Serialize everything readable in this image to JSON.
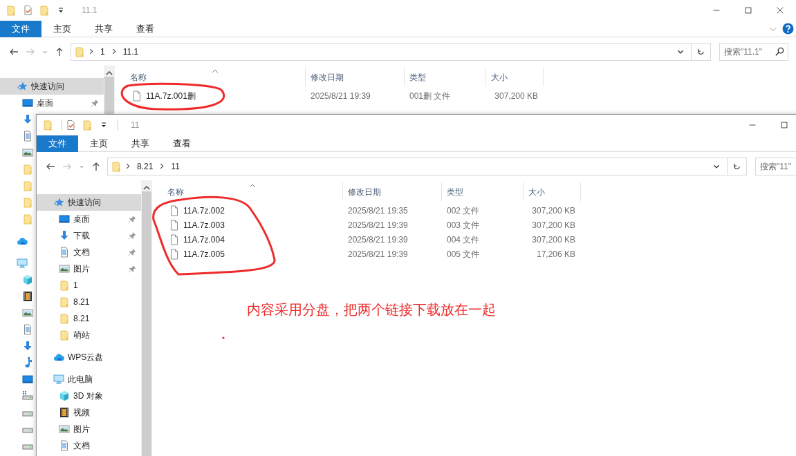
{
  "windows": [
    {
      "title": "11.1",
      "quick_access": [
        {
          "kind": "folder"
        },
        {
          "kind": "properties"
        },
        {
          "kind": "folder"
        },
        {
          "kind": "customize"
        }
      ],
      "controls": [
        {
          "kind": "minimize"
        },
        {
          "kind": "maximize"
        },
        {
          "kind": "close"
        }
      ],
      "ribbon_tabs": [
        {
          "label": "文件",
          "selected": true
        },
        {
          "label": "主页",
          "selected": false
        },
        {
          "label": "共享",
          "selected": false
        },
        {
          "label": "查看",
          "selected": false
        }
      ],
      "ribbon_tools": [
        {
          "kind": "collapse"
        },
        {
          "kind": "help"
        }
      ],
      "nav_buttons": [
        {
          "kind": "back",
          "disabled": false
        },
        {
          "kind": "forward",
          "disabled": true
        },
        {
          "kind": "recent",
          "disabled": false
        },
        {
          "kind": "up",
          "disabled": false
        }
      ],
      "path": [
        "1",
        "11.1"
      ],
      "search": {
        "placeholder": "搜索\"11.1\""
      },
      "nav": [
        {
          "label": "快速访问",
          "kind": "star",
          "selected": true,
          "children": [
            {
              "label": "桌面",
              "kind": "desktop",
              "pinned": true,
              "selected": false
            },
            {
              "kind": "download"
            },
            {
              "kind": "document"
            },
            {
              "kind": "picture"
            },
            {
              "kind": "folder"
            },
            {
              "kind": "folder"
            },
            {
              "kind": "folder"
            },
            {
              "kind": "folder"
            }
          ]
        },
        {
          "kind": "cloud"
        },
        {
          "kind": "pc",
          "children": [
            {
              "kind": "cube"
            },
            {
              "kind": "video"
            },
            {
              "kind": "picture"
            },
            {
              "kind": "document"
            },
            {
              "kind": "download"
            },
            {
              "kind": "music"
            },
            {
              "kind": "desktop"
            },
            {
              "kind": "drive-win"
            },
            {
              "kind": "drive"
            },
            {
              "kind": "drive"
            },
            {
              "kind": "drive"
            }
          ]
        }
      ],
      "columns": [
        "名称",
        "修改日期",
        "类型",
        "大小"
      ],
      "files": [
        {
          "name": "11A.7z.001删",
          "date": "2025/8/21 19:39",
          "type": "001删 文件",
          "size": "307,200 KB"
        }
      ]
    },
    {
      "title": "11",
      "quick_access": [
        {
          "kind": "folder"
        },
        {
          "kind": "separator"
        },
        {
          "kind": "properties"
        },
        {
          "kind": "folder"
        },
        {
          "kind": "customize"
        },
        {
          "kind": "separator"
        }
      ],
      "controls": [
        {
          "kind": "minimize"
        },
        {
          "kind": "maximize"
        }
      ],
      "ribbon_tabs": [
        {
          "label": "文件",
          "selected": true
        },
        {
          "label": "主页",
          "selected": false
        },
        {
          "label": "共享",
          "selected": false
        },
        {
          "label": "查看",
          "selected": false
        }
      ],
      "nav_buttons": [
        {
          "kind": "back",
          "disabled": false
        },
        {
          "kind": "forward",
          "disabled": true
        },
        {
          "kind": "recent",
          "disabled": false
        },
        {
          "kind": "up",
          "disabled": false
        }
      ],
      "path": [
        "8.21",
        "11"
      ],
      "search": {
        "placeholder": "搜索\"11\""
      },
      "nav": [
        {
          "label": "快速访问",
          "kind": "star",
          "selected": true,
          "children": [
            {
              "label": "桌面",
              "kind": "desktop",
              "pinned": true,
              "selected": false
            },
            {
              "label": "下载",
              "kind": "download",
              "pinned": true,
              "selected": false
            },
            {
              "label": "文档",
              "kind": "document",
              "pinned": true,
              "selected": false
            },
            {
              "label": "图片",
              "kind": "picture",
              "pinned": true,
              "selected": false
            },
            {
              "label": "1",
              "kind": "folder",
              "pinned": false,
              "selected": false
            },
            {
              "label": "8.21",
              "kind": "folder",
              "pinned": false,
              "selected": false
            },
            {
              "label": "8.21",
              "kind": "folder",
              "pinned": false,
              "selected": false
            },
            {
              "label": "萌站",
              "kind": "folder",
              "pinned": false,
              "selected": false
            }
          ]
        },
        {
          "label": "WPS云盘",
          "kind": "cloud",
          "selected": false
        },
        {
          "label": "此电脑",
          "kind": "pc",
          "selected": false,
          "children": [
            {
              "label": "3D 对象",
              "kind": "cube",
              "selected": false
            },
            {
              "label": "视频",
              "kind": "video",
              "selected": false
            },
            {
              "label": "图片",
              "kind": "picture",
              "selected": false
            },
            {
              "label": "文档",
              "kind": "document",
              "selected": false
            }
          ]
        }
      ],
      "columns": [
        "名称",
        "修改日期",
        "类型",
        "大小"
      ],
      "files": [
        {
          "name": "11A.7z.002",
          "date": "2025/8/21 19:35",
          "type": "002 文件",
          "size": "307,200 KB"
        },
        {
          "name": "11A.7z.003",
          "date": "2025/8/21 19:39",
          "type": "003 文件",
          "size": "307,200 KB"
        },
        {
          "name": "11A.7z.004",
          "date": "2025/8/21 19:39",
          "type": "004 文件",
          "size": "307,200 KB"
        },
        {
          "name": "11A.7z.005",
          "date": "2025/8/21 19:39",
          "type": "005 文件",
          "size": "17,206 KB"
        }
      ]
    }
  ],
  "annotation": {
    "note": "内容采用分盘，把两个链接下载放在一起"
  }
}
